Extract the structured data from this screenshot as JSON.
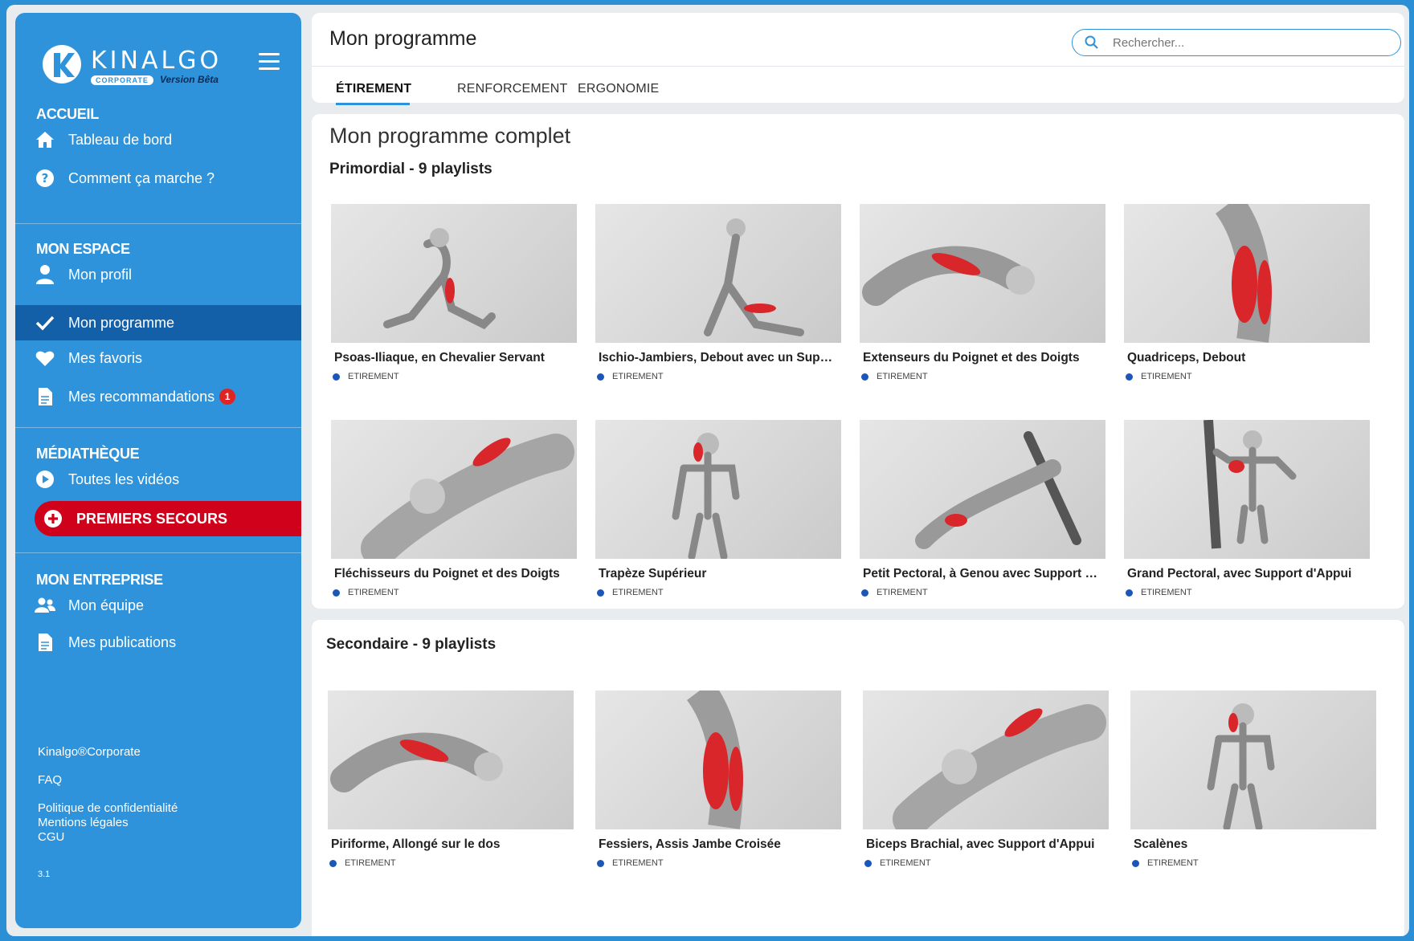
{
  "brand": {
    "name": "KINALGO",
    "sub": "CORPORATE",
    "beta": "Version Bêta"
  },
  "sidebar": {
    "sections": [
      {
        "title": "ACCUEIL",
        "items": [
          {
            "label": "Tableau de bord",
            "icon": "home-icon"
          },
          {
            "label": "Comment ça marche ?",
            "icon": "help-circle-icon"
          }
        ]
      },
      {
        "title": "MON ESPACE",
        "items": [
          {
            "label": "Mon profil",
            "icon": "user-icon"
          },
          {
            "label": "Mon programme",
            "icon": "check-icon",
            "active": true
          },
          {
            "label": "Mes favoris",
            "icon": "heart-icon"
          },
          {
            "label": "Mes recommandations",
            "icon": "document-icon",
            "badge": "1"
          }
        ]
      },
      {
        "title": "MÉDIATHÈQUE",
        "items": [
          {
            "label": "Toutes les vidéos",
            "icon": "play-circle-icon"
          },
          {
            "label": "PREMIERS SECOURS",
            "icon": "plus-circle-icon",
            "urgent": true
          }
        ]
      },
      {
        "title": "MON ENTREPRISE",
        "items": [
          {
            "label": "Mon équipe",
            "icon": "team-icon"
          },
          {
            "label": "Mes publications",
            "icon": "document-icon"
          }
        ]
      }
    ],
    "footer": {
      "corporate": "Kinalgo®Corporate",
      "faq": "FAQ",
      "privacy": "Politique de confidentialité",
      "legal": "Mentions légales",
      "cgu": "CGU",
      "version": "3.1"
    }
  },
  "header": {
    "title": "Mon programme",
    "search_placeholder": "Rechercher...",
    "tabs": [
      "ÉTIREMENT",
      "RENFORCEMENT",
      "ERGONOMIE"
    ]
  },
  "program": {
    "title": "Mon programme complet",
    "primary": {
      "heading": "Primordial - 9 playlists",
      "cards": [
        {
          "title": "Psoas-Iliaque, en Chevalier Servant",
          "tag": "ETIREMENT"
        },
        {
          "title": "Ischio-Jambiers, Debout avec un Suppor...",
          "tag": "ETIREMENT"
        },
        {
          "title": "Extenseurs du Poignet et des Doigts",
          "tag": "ETIREMENT"
        },
        {
          "title": "Quadriceps, Debout",
          "tag": "ETIREMENT"
        },
        {
          "title": "Fléchisseurs du Poignet et des Doigts",
          "tag": "ETIREMENT"
        },
        {
          "title": "Trapèze Supérieur",
          "tag": "ETIREMENT"
        },
        {
          "title": "Petit Pectoral, à Genou avec Support D'A...",
          "tag": "ETIREMENT"
        },
        {
          "title": "Grand Pectoral, avec Support d'Appui",
          "tag": "ETIREMENT"
        }
      ]
    },
    "secondary": {
      "heading": "Secondaire - 9 playlists",
      "cards": [
        {
          "title": "Piriforme, Allongé sur le dos",
          "tag": "ETIREMENT"
        },
        {
          "title": "Fessiers, Assis Jambe Croisée",
          "tag": "ETIREMENT"
        },
        {
          "title": "Biceps Brachial, avec Support d'Appui",
          "tag": "ETIREMENT"
        },
        {
          "title": "Scalènes",
          "tag": "ETIREMENT"
        }
      ]
    }
  },
  "colors": {
    "sidebar": "#2e93db",
    "active": "#1460a8",
    "urgent": "#d0021b",
    "muscle": "#d9262b"
  }
}
